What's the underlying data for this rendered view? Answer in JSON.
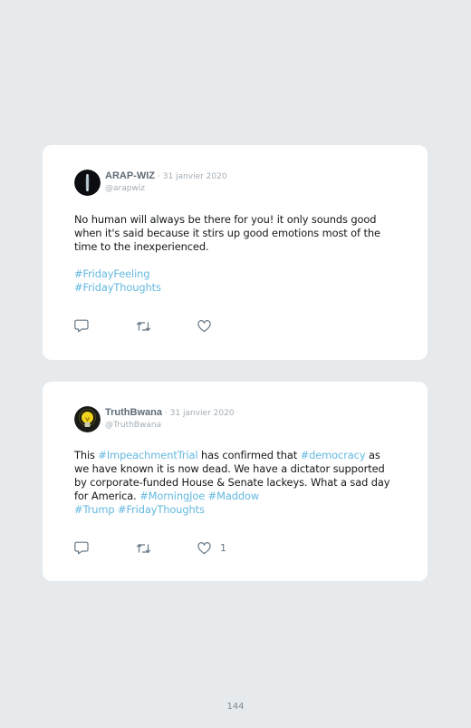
{
  "tweets": [
    {
      "author_name": "ARAP-WIZ",
      "date": "· 31 janvier 2020",
      "handle": "@arapwiz",
      "body": "No human will always be there for you! it only sounds good when it's said because it stirs up good emotions most of the time to the inexperienced.",
      "hashtags": [
        "#FridayFeeling",
        "#FridayThoughts"
      ],
      "like_count": ""
    },
    {
      "author_name": "TruthBwana",
      "date": "· 31 janvier 2020",
      "handle": "@TruthBwana",
      "body_parts": {
        "p1": "This ",
        "h1": "#ImpeachmentTrial",
        "p2": " has confirmed that ",
        "h2": "#democracy",
        "p3": " as we have known it is now dead. We have a dictator supported by corporate-funded House & Senate lackeys. What a sad day for America. ",
        "h3": "#MorningJoe",
        "p4": " ",
        "h4": "#Maddow",
        "h5": "#Trump",
        "p5": " ",
        "h6": "#FridayThoughts"
      },
      "like_count": "1"
    }
  ],
  "icons": {
    "reply": "reply-icon",
    "retweet": "retweet-icon",
    "like": "heart-icon"
  },
  "colors": {
    "background": "#e6eaed",
    "card": "#ffffff",
    "hashtag": "#63b8e0",
    "icon": "#657786"
  },
  "page_number": "144"
}
